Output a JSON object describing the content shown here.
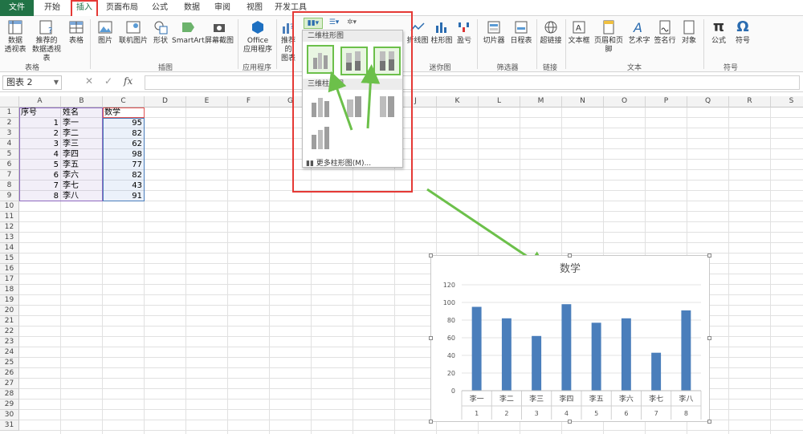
{
  "ribbon_tabs": [
    "文件",
    "开始",
    "插入",
    "页面布局",
    "公式",
    "数据",
    "审阅",
    "视图",
    "开发工具"
  ],
  "ribbon_buttons": {
    "pivot": "数据\n透视表",
    "recommended_pivot": "推荐的\n数据透视表",
    "table": "表格",
    "pictures": "图片",
    "online_pictures": "联机图片",
    "shapes": "形状",
    "smartart": "SmartArt",
    "screenshot": "屏幕截图",
    "office_apps": "Office\n应用程序",
    "recommended_charts": "推荐的\n图表",
    "line_spark": "折线图",
    "column_spark": "柱形图",
    "winloss": "盈亏",
    "slicer": "切片器",
    "timeline": "日程表",
    "hyperlink": "超链接",
    "textbox": "文本框",
    "header_footer": "页眉和页脚",
    "wordart": "艺术字",
    "signature": "签名行",
    "object": "对象",
    "equation": "公式",
    "symbol": "符号"
  },
  "ribbon_groups": {
    "tables": "表格",
    "illustrations": "插图",
    "apps": "应用程序",
    "sparklines": "迷你图",
    "filters": "筛选器",
    "links": "链接",
    "text": "文本",
    "symbols": "符号"
  },
  "name_box": "图表 2",
  "fx_label": "fx",
  "columns": [
    "A",
    "B",
    "C",
    "D",
    "E",
    "F",
    "G",
    "H",
    "I",
    "J",
    "K",
    "L",
    "M",
    "N",
    "O",
    "P",
    "Q",
    "R",
    "S"
  ],
  "table": {
    "headers": [
      "序号",
      "姓名",
      "数学"
    ],
    "rows": [
      [
        "1",
        "李一",
        "95"
      ],
      [
        "2",
        "李二",
        "82"
      ],
      [
        "3",
        "李三",
        "62"
      ],
      [
        "4",
        "李四",
        "98"
      ],
      [
        "5",
        "李五",
        "77"
      ],
      [
        "6",
        "李六",
        "82"
      ],
      [
        "7",
        "李七",
        "43"
      ],
      [
        "8",
        "李八",
        "91"
      ]
    ]
  },
  "dropdown": {
    "section_2d": "二维柱形图",
    "section_3d": "三维柱形图",
    "more": "更多柱形图(M)..."
  },
  "chart_data": {
    "type": "bar",
    "title": "数学",
    "categories": [
      "李一",
      "李二",
      "李三",
      "李四",
      "李五",
      "李六",
      "李七",
      "李八"
    ],
    "sub_categories": [
      "1",
      "2",
      "3",
      "4",
      "5",
      "6",
      "7",
      "8"
    ],
    "values": [
      95,
      82,
      62,
      98,
      77,
      82,
      43,
      91
    ],
    "ylim": [
      0,
      120
    ],
    "yticks": [
      0,
      20,
      40,
      60,
      80,
      100,
      120
    ],
    "bar_color": "#4a7ebb",
    "grid": true,
    "legend": "none"
  },
  "colors": {
    "excel_green": "#217346",
    "highlight_red": "#e53935",
    "arrow_green": "#6cc04a"
  }
}
